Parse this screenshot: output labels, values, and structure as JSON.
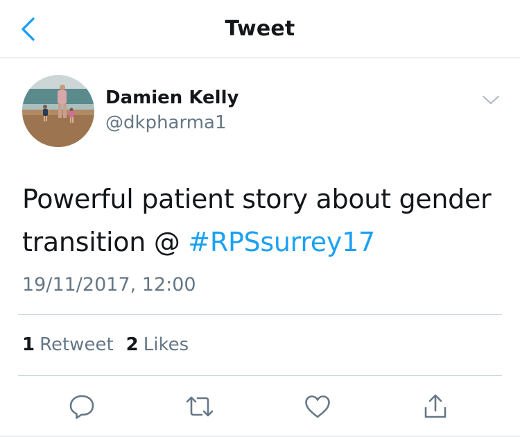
{
  "header": {
    "title": "Tweet"
  },
  "author": {
    "name": "Damien Kelly",
    "handle": "@dkpharma1"
  },
  "tweet": {
    "text": "Powerful patient story about gender transition @ ",
    "hashtag": "#RPSsurrey17",
    "timestamp": "19/11/2017, 12:00"
  },
  "stats": {
    "retweet_count": "1",
    "retweet_label": "Retweet",
    "like_count": "2",
    "like_label": "Likes"
  },
  "icons": {
    "back": "chevron-left-icon",
    "menu": "chevron-down-icon",
    "reply": "reply-icon",
    "retweet": "retweet-icon",
    "like": "heart-icon",
    "share": "share-icon"
  },
  "colors": {
    "accent": "#1da1f2",
    "text": "#14171a",
    "secondary": "#657786",
    "icon": "#657786",
    "divider": "#ccd6dd"
  }
}
